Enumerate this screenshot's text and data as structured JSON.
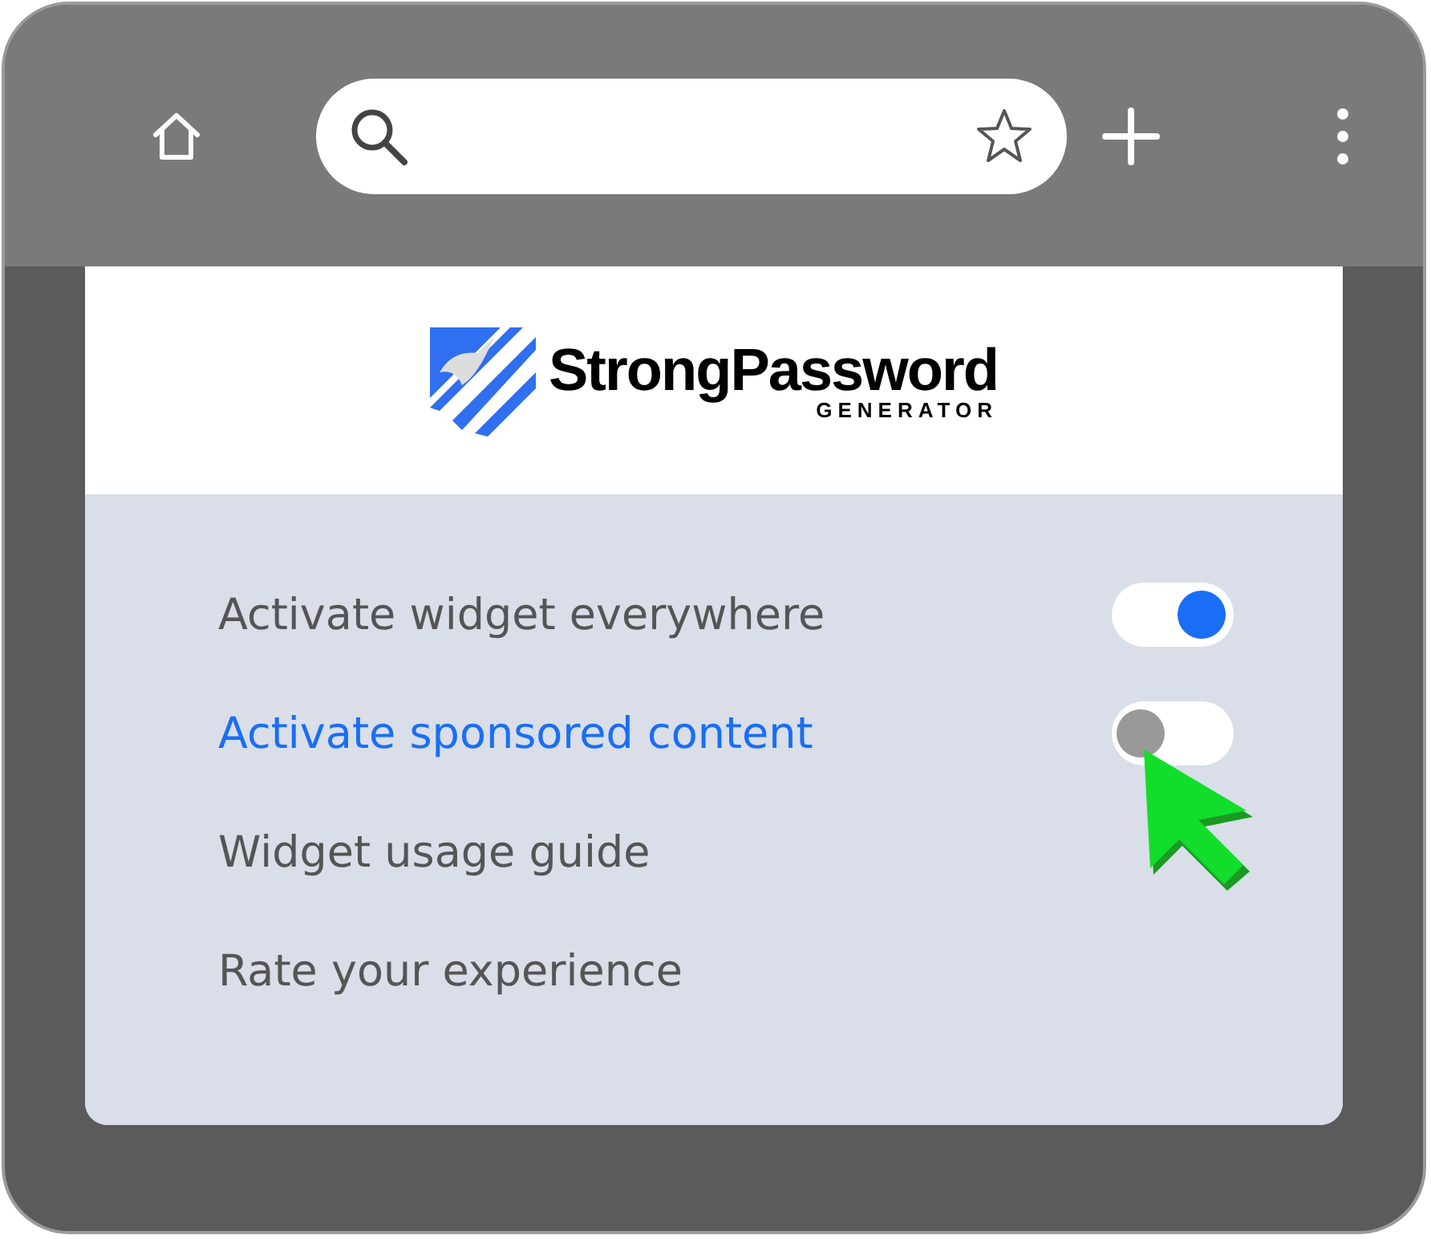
{
  "logo": {
    "name": "StrongPassword",
    "tagline": "GENERATOR"
  },
  "items": [
    {
      "kind": "toggle",
      "label": "Activate widget everywhere",
      "highlighted": false,
      "on": true
    },
    {
      "kind": "toggle",
      "label": "Activate sponsored content",
      "highlighted": true,
      "on": false
    },
    {
      "kind": "link",
      "label": "Widget usage guide",
      "highlighted": false
    },
    {
      "kind": "link",
      "label": "Rate your experience",
      "highlighted": false
    }
  ]
}
